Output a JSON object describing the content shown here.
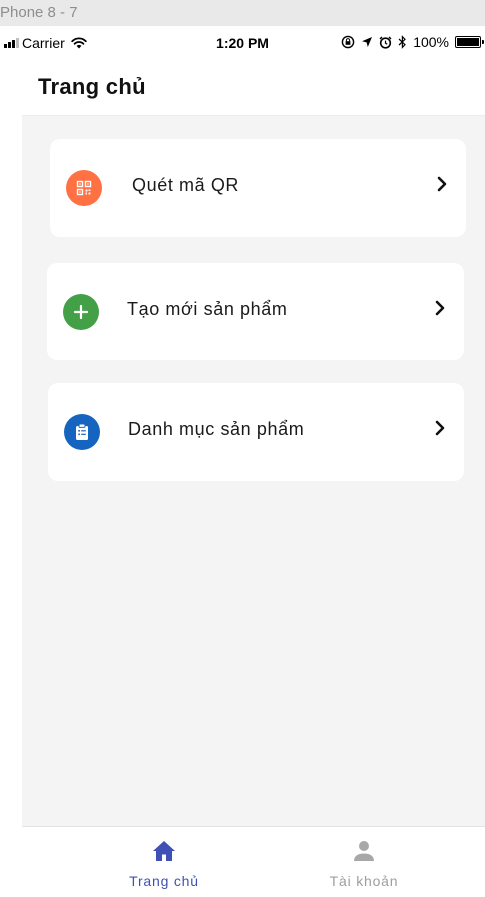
{
  "simulator": {
    "title": "Phone 8 - 7"
  },
  "status_bar": {
    "carrier": "Carrier",
    "time": "1:20 PM",
    "battery": "100%"
  },
  "header": {
    "title": "Trang chủ"
  },
  "menu": {
    "items": [
      {
        "label": "Quét mã QR",
        "icon": "qr-code-icon",
        "color": "#ff7043"
      },
      {
        "label": "Tạo mới sản phẩm",
        "icon": "plus-icon",
        "color": "#43a047"
      },
      {
        "label": "Danh mục sản phẩm",
        "icon": "clipboard-list-icon",
        "color": "#1565c0"
      }
    ]
  },
  "tab_bar": {
    "items": [
      {
        "label": "Trang chủ",
        "icon": "home-icon",
        "active": true,
        "color": "#3f51b5"
      },
      {
        "label": "Tài khoản",
        "icon": "user-icon",
        "active": false,
        "color": "#9e9e9e"
      }
    ]
  }
}
